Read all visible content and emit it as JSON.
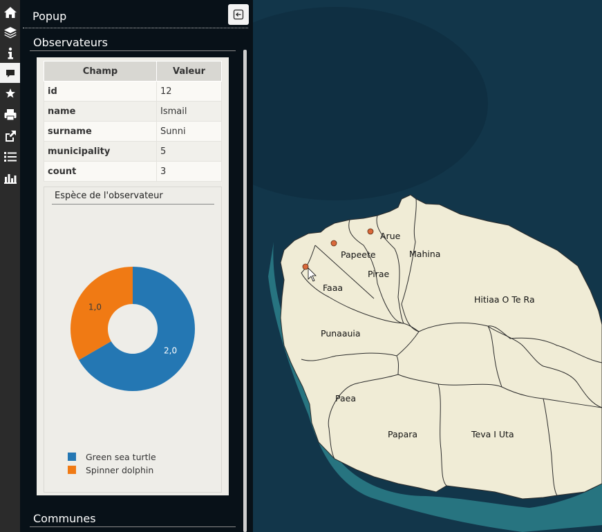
{
  "toolbar": {
    "icons": [
      "home-icon",
      "layers-icon",
      "info-icon",
      "popup-icon",
      "bookmark-icon",
      "print-icon",
      "share-icon",
      "list-icon",
      "chart-icon"
    ],
    "active": "popup-icon"
  },
  "popup": {
    "title": "Popup"
  },
  "observers": {
    "section_title": "Observateurs",
    "table": {
      "headers": [
        "Champ",
        "Valeur"
      ],
      "rows": [
        [
          "id",
          "12"
        ],
        [
          "name",
          "Ismail"
        ],
        [
          "surname",
          "Sunni"
        ],
        [
          "municipality",
          "5"
        ],
        [
          "count",
          "3"
        ]
      ]
    },
    "chart_title": "Espèce de l'observateur"
  },
  "chart_data": {
    "type": "pie",
    "donut": true,
    "title": "Espèce de l'observateur",
    "categories": [
      "Green sea turtle",
      "Spinner dolphin"
    ],
    "values": [
      2.0,
      1.0
    ],
    "data_labels": [
      "2,0",
      "1,0"
    ],
    "colors": [
      "#2477b3",
      "#f07a14"
    ],
    "legend": "bottom-left"
  },
  "communes": {
    "section_title": "Communes"
  },
  "map": {
    "labels": [
      "Arue",
      "Papeete",
      "Mahina",
      "Pirae",
      "Faaa",
      "Hitiaa O Te Ra",
      "Punaauia",
      "Paea",
      "Papara",
      "Teva I Uta"
    ],
    "land_color": "#f0ecd6",
    "sea_color": "#12364a",
    "point_color": "#d9683a"
  }
}
